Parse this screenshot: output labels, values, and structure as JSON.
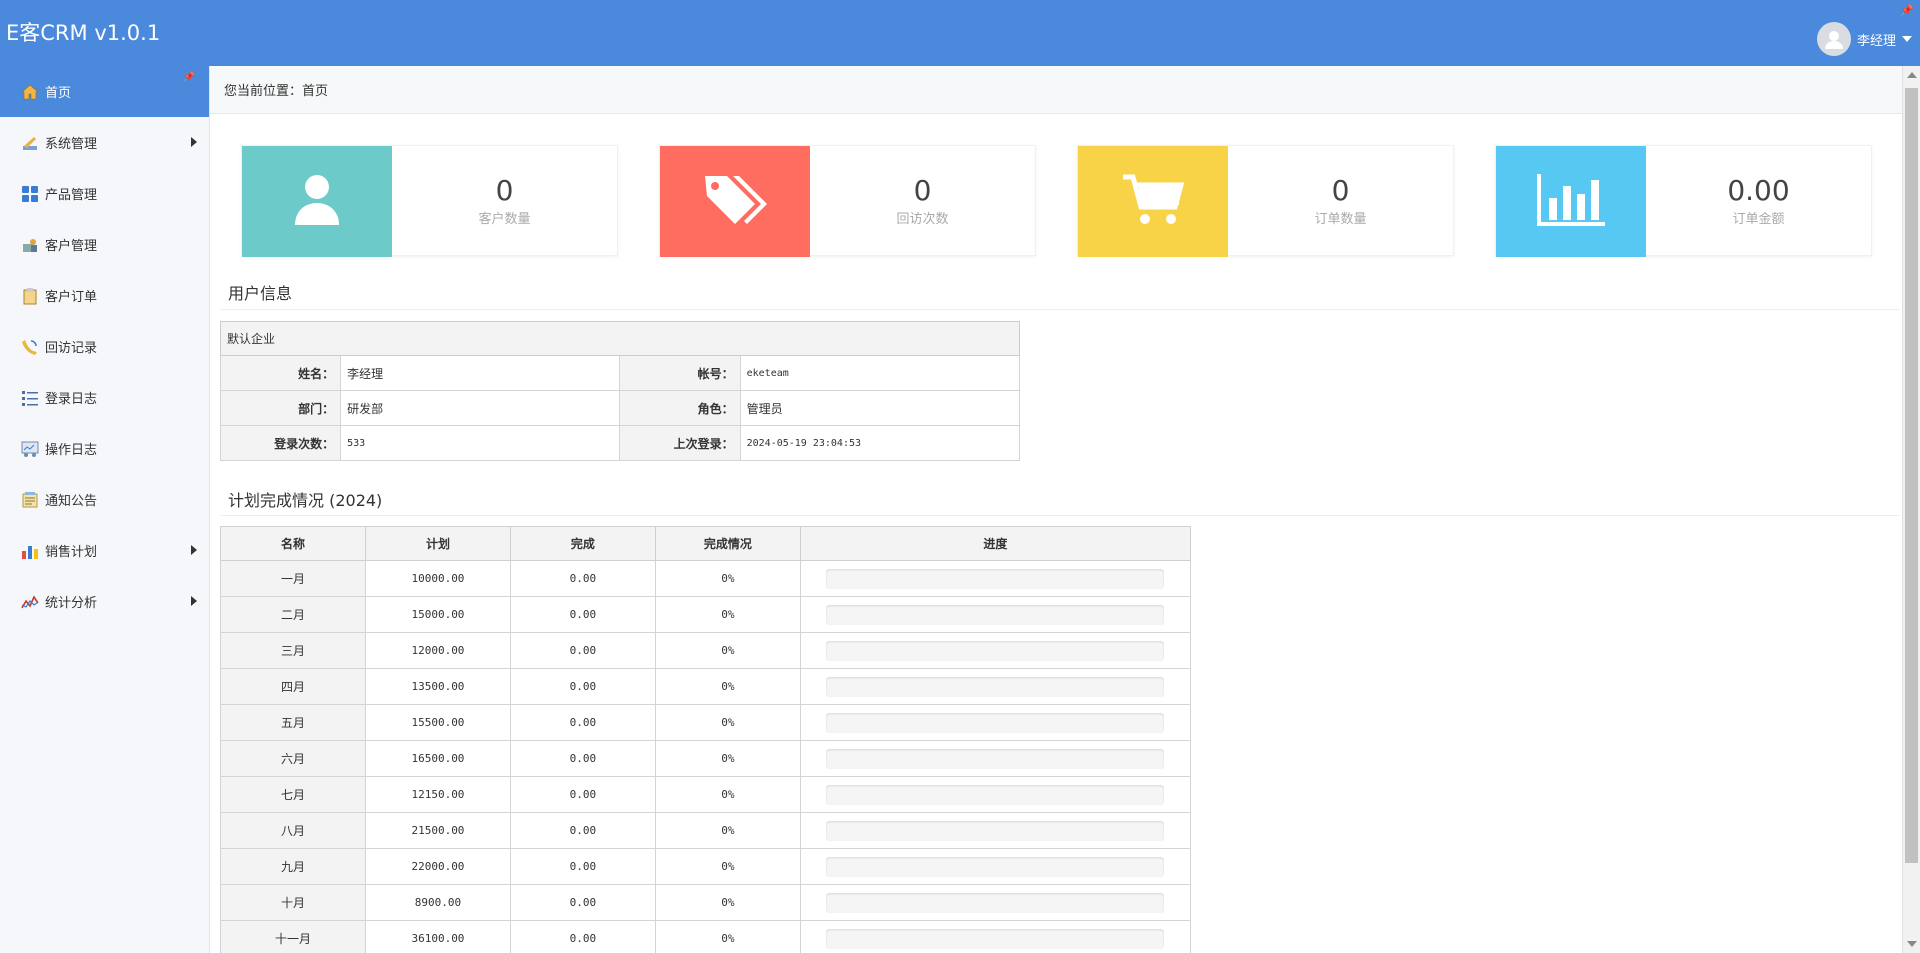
{
  "app": {
    "title": "E客CRM v1.0.1",
    "user_name": "李经理"
  },
  "sidebar": {
    "items": [
      {
        "label": "首页",
        "icon": "home-icon",
        "active": true,
        "has_arrow": false
      },
      {
        "label": "系统管理",
        "icon": "settings-icon",
        "active": false,
        "has_arrow": true
      },
      {
        "label": "产品管理",
        "icon": "grid-icon",
        "active": false,
        "has_arrow": false
      },
      {
        "label": "客户管理",
        "icon": "customers-icon",
        "active": false,
        "has_arrow": false
      },
      {
        "label": "客户订单",
        "icon": "clipboard-icon",
        "active": false,
        "has_arrow": false
      },
      {
        "label": "回访记录",
        "icon": "phone-icon",
        "active": false,
        "has_arrow": false
      },
      {
        "label": "登录日志",
        "icon": "list-icon",
        "active": false,
        "has_arrow": false
      },
      {
        "label": "操作日志",
        "icon": "log-icon",
        "active": false,
        "has_arrow": false
      },
      {
        "label": "通知公告",
        "icon": "notice-icon",
        "active": false,
        "has_arrow": false
      },
      {
        "label": "销售计划",
        "icon": "bar-chart-icon",
        "active": false,
        "has_arrow": true
      },
      {
        "label": "统计分析",
        "icon": "line-chart-icon",
        "active": false,
        "has_arrow": true
      }
    ]
  },
  "breadcrumb": {
    "text": "您当前位置：首页"
  },
  "stats": [
    {
      "value": "0",
      "label": "客户数量",
      "color": "#6ccac9",
      "icon": "user-icon"
    },
    {
      "value": "0",
      "label": "回访次数",
      "color": "#ff6c60",
      "icon": "tags-icon"
    },
    {
      "value": "0",
      "label": "订单数量",
      "color": "#f8d347",
      "icon": "cart-icon"
    },
    {
      "value": "0.00",
      "label": "订单金额",
      "color": "#57c8f2",
      "icon": "bar-chart-icon"
    }
  ],
  "user_info": {
    "title": "用户信息",
    "company": "默认企业",
    "rows": [
      {
        "k1": "姓名：",
        "v1": "李经理",
        "k2": "帐号：",
        "v2": "eketeam"
      },
      {
        "k1": "部门：",
        "v1": "研发部",
        "k2": "角色：",
        "v2": "管理员"
      },
      {
        "k1": "登录次数：",
        "v1": "533",
        "k2": "上次登录：",
        "v2": "2024-05-19 23:04:53"
      }
    ]
  },
  "plan": {
    "title": "计划完成情况 (2024)",
    "headers": [
      "名称",
      "计划",
      "完成",
      "完成情况",
      "进度"
    ],
    "rows": [
      {
        "name": "一月",
        "plan": "10000.00",
        "done": "0.00",
        "rate": "0%",
        "progress": 0
      },
      {
        "name": "二月",
        "plan": "15000.00",
        "done": "0.00",
        "rate": "0%",
        "progress": 0
      },
      {
        "name": "三月",
        "plan": "12000.00",
        "done": "0.00",
        "rate": "0%",
        "progress": 0
      },
      {
        "name": "四月",
        "plan": "13500.00",
        "done": "0.00",
        "rate": "0%",
        "progress": 0
      },
      {
        "name": "五月",
        "plan": "15500.00",
        "done": "0.00",
        "rate": "0%",
        "progress": 0
      },
      {
        "name": "六月",
        "plan": "16500.00",
        "done": "0.00",
        "rate": "0%",
        "progress": 0
      },
      {
        "name": "七月",
        "plan": "12150.00",
        "done": "0.00",
        "rate": "0%",
        "progress": 0
      },
      {
        "name": "八月",
        "plan": "21500.00",
        "done": "0.00",
        "rate": "0%",
        "progress": 0
      },
      {
        "name": "九月",
        "plan": "22000.00",
        "done": "0.00",
        "rate": "0%",
        "progress": 0
      },
      {
        "name": "十月",
        "plan": "8900.00",
        "done": "0.00",
        "rate": "0%",
        "progress": 0
      },
      {
        "name": "十一月",
        "plan": "36100.00",
        "done": "0.00",
        "rate": "0%",
        "progress": 0
      }
    ]
  }
}
